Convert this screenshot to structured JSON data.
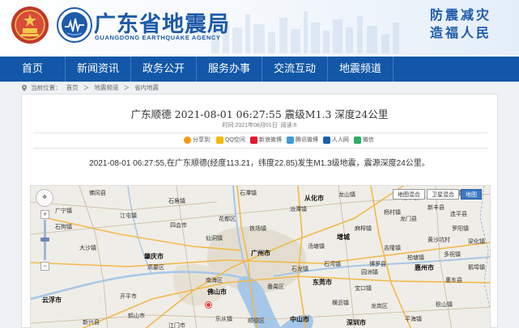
{
  "header": {
    "agency_cn": "广东省地震局",
    "agency_en": "GUANGDONG EARTHQUAKE AGENCY",
    "slogan_line1": "防震减灾",
    "slogan_line2": "造福人民",
    "emblem_icon": "national-emblem-icon",
    "logo_icon": "earthquake-agency-logo-icon"
  },
  "nav": {
    "items": [
      "首页",
      "新闻资讯",
      "政务公开",
      "服务办事",
      "交流互动",
      "地震频道"
    ]
  },
  "breadcrumb": {
    "prefix": "当前位置：",
    "items": [
      "首页",
      "地震频道",
      "省内地震"
    ],
    "separator": "＞"
  },
  "article": {
    "title": "广东顺德  2021-08-01  06:27:55  震级M1.3  深度24公里",
    "time_label": "时间:2021年08月01日",
    "views_label": "阅读:6",
    "share": {
      "label": "分享到:",
      "targets": [
        "QQ空间",
        "新浪微博",
        "腾讯微博",
        "人人网",
        "微信"
      ]
    },
    "body": "2021-08-01 06:27:55,在广东顺德(经度113.21，纬度22.85)发生M1.3级地震，震源深度24公里。"
  },
  "map": {
    "types": [
      "地图混合",
      "卫星混合",
      "地图"
    ],
    "active_type": "地图",
    "cities": [
      "佛冈县",
      "石角镇",
      "龙山镇",
      "石潭镇",
      "从化市",
      "龙华镇",
      "新丰县",
      "梅河镇",
      "广宁镇",
      "江屯镇",
      "四会市",
      "石狗镇",
      "花都区",
      "增城",
      "派潭镇",
      "龙门县",
      "麻榨镇",
      "罗阳镇",
      "连平县",
      "黄沙坑村",
      "柏塘镇",
      "园洲镇",
      "铁场镇",
      "仙洞镇",
      "汤塘镇",
      "肇庆市",
      "大沙镇",
      "高要区",
      "广州市",
      "番禺区",
      "东莞市",
      "石龙镇",
      "石湾镇",
      "博罗县",
      "惠州市",
      "惠东县",
      "稔山镇",
      "佛山市",
      "南海区",
      "乐从镇",
      "顺德区",
      "中山市",
      "云浮市",
      "新兴县",
      "鹤山市",
      "江门市",
      "开平市",
      "深圳市",
      "龙岗区",
      "鹅埠镇",
      "平海镇",
      "多祝镇",
      "吉隆镇",
      "梁化镇",
      "宝口镇",
      "横沥镇",
      "杨村镇"
    ],
    "epicenter_label": "顺德区",
    "controls": {
      "pan_icon": "pan-control-icon",
      "zoom_in": "+",
      "zoom_out": "−"
    }
  },
  "colors": {
    "brand_blue": "#1257a8",
    "agency_text": "#1d5aa8",
    "epicenter": "#e23b2e",
    "map_bg": "#efede7",
    "water": "#a6c7e8"
  }
}
